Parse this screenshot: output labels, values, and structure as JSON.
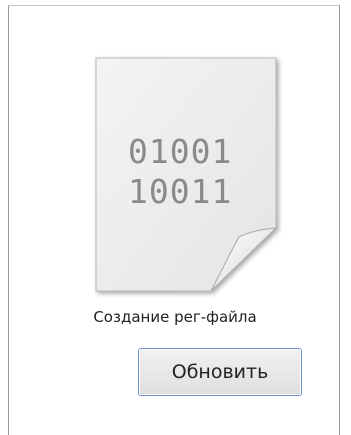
{
  "panel": {
    "icon": "binary-file-icon",
    "file_digits_line1": "01001",
    "file_digits_line2": "10011",
    "caption": "Создание рег-файла",
    "refresh_label": "Обновить"
  }
}
